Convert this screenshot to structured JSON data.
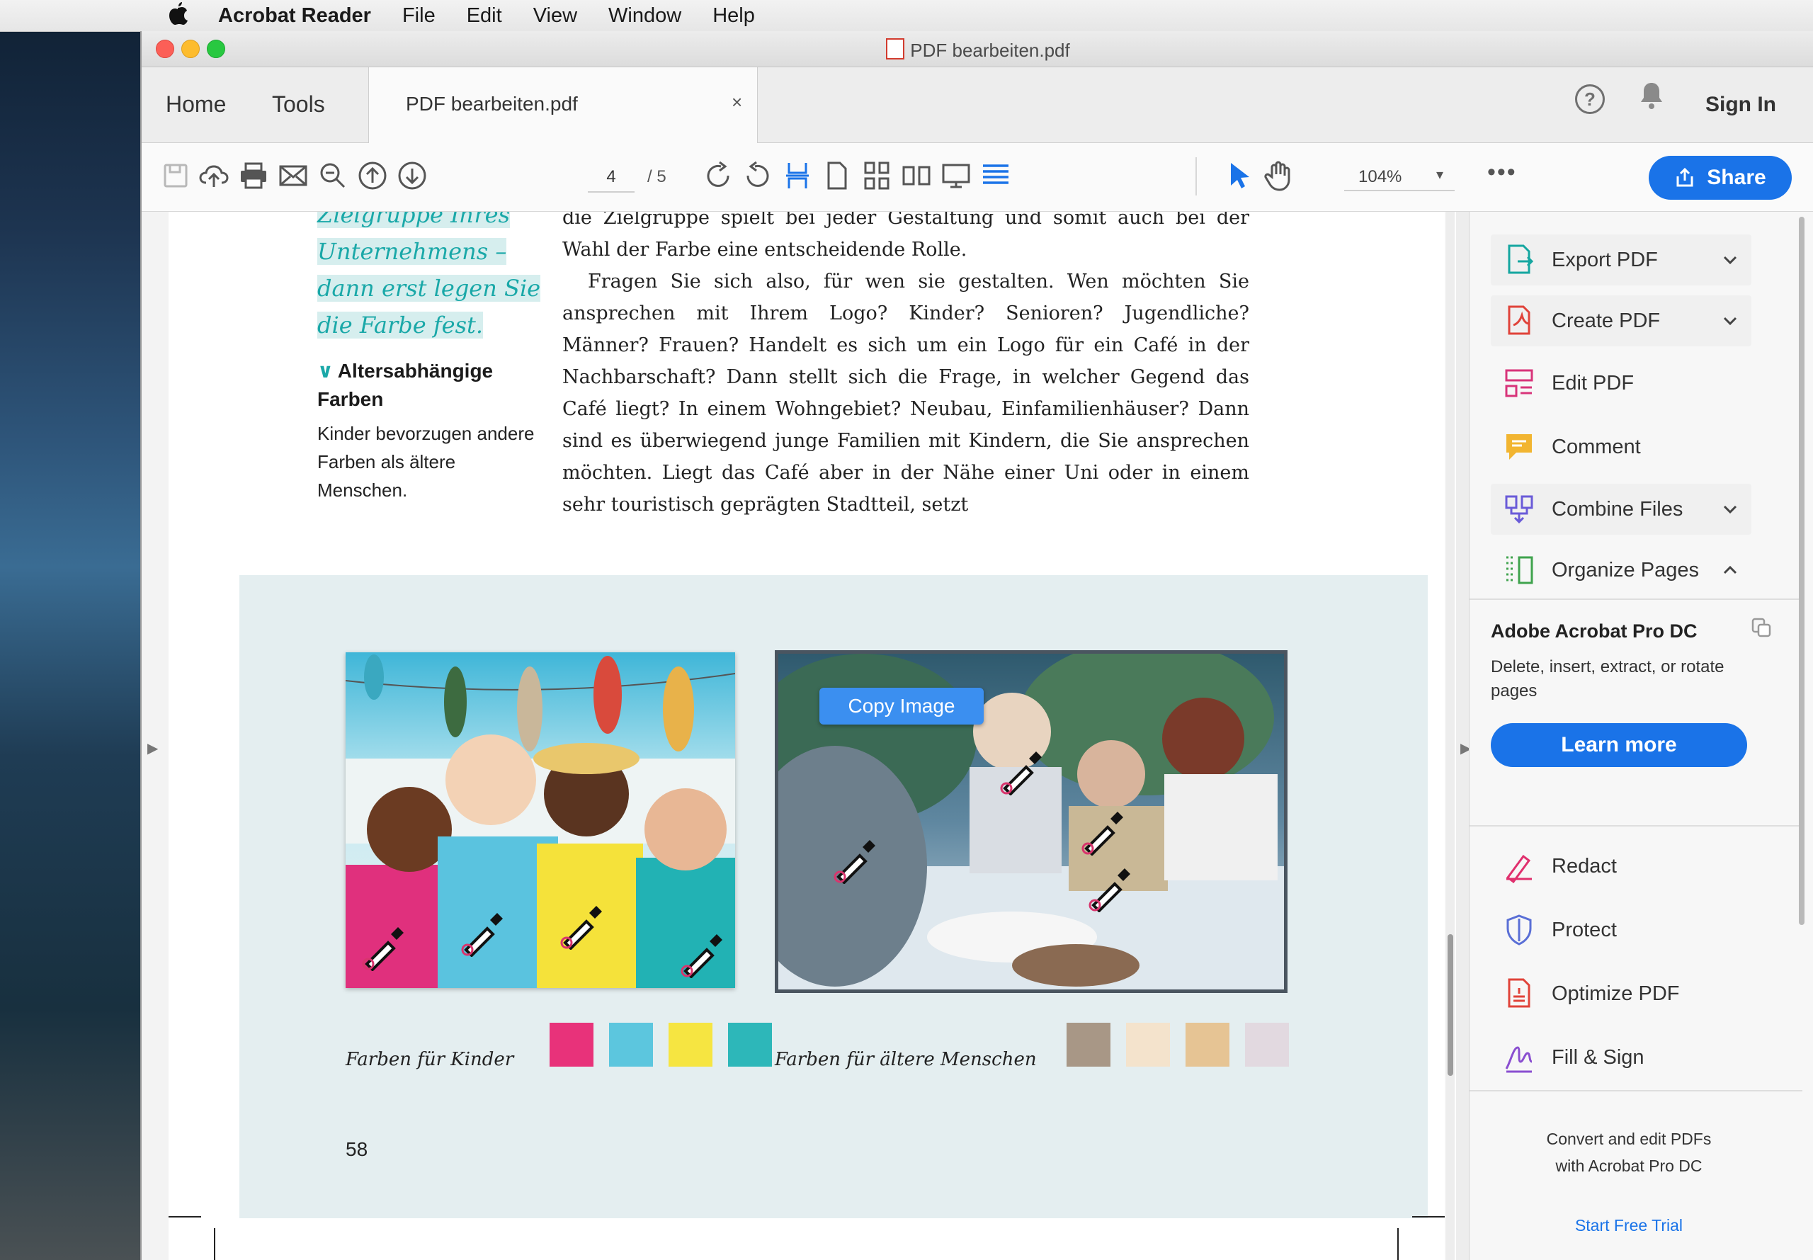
{
  "menubar": {
    "app_name": "Acrobat Reader",
    "items": [
      "File",
      "Edit",
      "View",
      "Window",
      "Help"
    ]
  },
  "window": {
    "title": "PDF bearbeiten.pdf"
  },
  "tabs": {
    "home": "Home",
    "tools": "Tools",
    "document": "PDF bearbeiten.pdf",
    "close": "×",
    "help": "?",
    "sign_in": "Sign In"
  },
  "toolbar": {
    "current_page": "4",
    "total_pages": "/ 5",
    "zoom": "104%",
    "more": "•••",
    "share": "Share",
    "icons": [
      "save-icon",
      "upload-cloud-icon",
      "print-icon",
      "email-icon",
      "zoom-out-icon",
      "page-up-icon",
      "page-down-icon",
      "rotate-clockwise-icon",
      "rotate-counterclockwise-icon",
      "fit-width-icon",
      "single-page-icon",
      "scrolling-pages-icon",
      "two-page-icon",
      "presentation-icon",
      "read-mode-icon",
      "select-cursor-icon",
      "hand-tool-icon"
    ]
  },
  "document": {
    "sidenote_script": [
      "Zielgruppe Ihres",
      "Unternehmens –",
      "dann erst legen Sie",
      "die Farbe fest."
    ],
    "side_heading": "Altersabhängige Farben",
    "side_text": "Kinder bevorzugen andere Farben als ältere Menschen.",
    "body_p1": "die Zielgruppe spielt bei jeder Gestaltung und somit auch bei der Wahl der Farbe eine entscheidende Rolle.",
    "body_p2": "Fragen Sie sich also, für wen sie gestalten. Wen möchten Sie ansprechen mit Ihrem Logo? Kinder? Senioren? Jugendliche? Männer? Frauen? Handelt es sich um ein Logo für ein Café in der Nachbarschaft? Dann stellt sich die Frage, in welcher Gegend das Café liegt? In einem Wohngebiet? Neubau, Einfamilienhäuser? Dann sind es überwiegend junge Familien mit Kindern, die Sie ansprechen möchten. Liegt das Café aber in der Nähe einer Uni oder in einem sehr touristisch geprägten Stadtteil, setzt",
    "caption_kids": "Farben für Kinder",
    "caption_seniors": "Farben für ältere Menschen",
    "swatches_kids": [
      "#e8327a",
      "#5cc6de",
      "#f6e541",
      "#2db7b9"
    ],
    "swatches_seniors": [
      "#a89786",
      "#f4e3cc",
      "#e6c494",
      "#e2d9e0"
    ],
    "page_number": "58",
    "context_popup": "Copy Image"
  },
  "tools_pane": {
    "items": [
      {
        "label": "Export PDF",
        "icon": "export-pdf-icon",
        "expand": "chevron-down"
      },
      {
        "label": "Create PDF",
        "icon": "create-pdf-icon",
        "expand": "chevron-down"
      },
      {
        "label": "Edit PDF",
        "icon": "edit-pdf-icon",
        "expand": ""
      },
      {
        "label": "Comment",
        "icon": "comment-icon",
        "expand": ""
      },
      {
        "label": "Combine Files",
        "icon": "combine-files-icon",
        "expand": "chevron-down"
      },
      {
        "label": "Organize Pages",
        "icon": "organize-pages-icon",
        "expand": "chevron-up"
      }
    ],
    "pro": {
      "title": "Adobe Acrobat Pro DC",
      "description": "Delete, insert, extract, or rotate pages",
      "button": "Learn more"
    },
    "more_items": [
      {
        "label": "Redact",
        "icon": "redact-icon"
      },
      {
        "label": "Protect",
        "icon": "protect-icon"
      },
      {
        "label": "Optimize PDF",
        "icon": "optimize-pdf-icon"
      },
      {
        "label": "Fill & Sign",
        "icon": "fill-sign-icon"
      }
    ],
    "footer_line1": "Convert and edit PDFs",
    "footer_line2": "with Acrobat Pro DC",
    "trial": "Start Free Trial"
  },
  "colors": {
    "accent": "#1a73e8",
    "teal": "#1aa8a8",
    "panel_bg": "#e4eef0"
  }
}
